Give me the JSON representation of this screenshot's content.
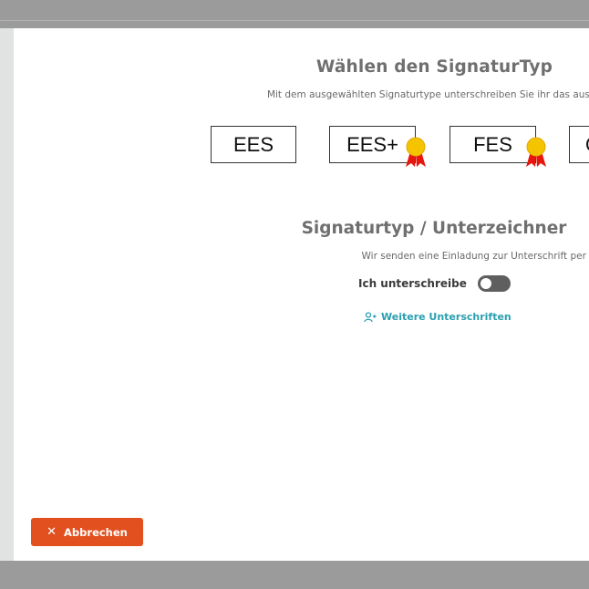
{
  "dialog": {
    "title": "Wählen den SignaturTyp",
    "subtitle": "Mit dem ausgewählten Signaturtype unterschreiben Sie ihr das ausge",
    "signature_types": [
      {
        "label": "EES",
        "badge": false
      },
      {
        "label": "EES+",
        "badge": true
      },
      {
        "label": "FES",
        "badge": true
      },
      {
        "label": "Q",
        "badge": false
      }
    ],
    "section_title": "Signaturtyp / Unterzeichner",
    "section_text": "Wir senden eine Einladung zur Unterschrift per E-Mail an alle, die zur Untersch",
    "self_sign_label": "Ich unterschreibe",
    "self_sign_enabled": false,
    "more_signatures_label": "Weitere Unterschriften",
    "cancel_label": "Abbrechen"
  },
  "colors": {
    "accent_teal": "#2a9fb0",
    "cancel_orange": "#e2501f",
    "badge_gold": "#f5c400",
    "badge_ribbon": "#e8170e"
  }
}
